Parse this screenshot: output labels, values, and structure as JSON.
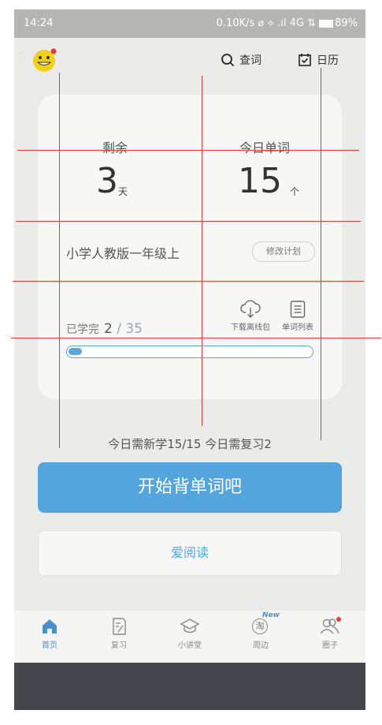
{
  "status": {
    "time": "14:24",
    "indicators": "0.10K/s ⌀ ⟡ .ıl 4G ⇅",
    "battery": "89%"
  },
  "header": {
    "search_label": "查词",
    "calendar_label": "日历"
  },
  "stats": {
    "remaining_label": "剩余",
    "remaining_value": "3",
    "remaining_unit": "天",
    "today_label": "今日单词",
    "today_value": "15",
    "today_unit": "个"
  },
  "plan": {
    "book": "小学人教版一年级上",
    "modify_label": "修改计划"
  },
  "progress": {
    "label": "已学完",
    "done": "2",
    "total": " / 35",
    "fraction": 0.057,
    "download_label": "下载离线包",
    "wordlist_label": "单词列表"
  },
  "summary": "今日需新学15/15  今日需复习2",
  "buttons": {
    "start": "开始背单词吧",
    "read": "爱阅读"
  },
  "tabs": [
    {
      "label": "首页",
      "icon": "home-icon"
    },
    {
      "label": "复习",
      "icon": "review-icon"
    },
    {
      "label": "小讲堂",
      "icon": "graduation-cap-icon"
    },
    {
      "label": "周边",
      "icon": "taobao-icon",
      "badge": "New",
      "glyph": "淘"
    },
    {
      "label": "圈子",
      "icon": "people-icon"
    }
  ],
  "colors": {
    "accent": "#54a5dd",
    "tab_active": "#4a90c8",
    "badge_red": "#e53935"
  }
}
